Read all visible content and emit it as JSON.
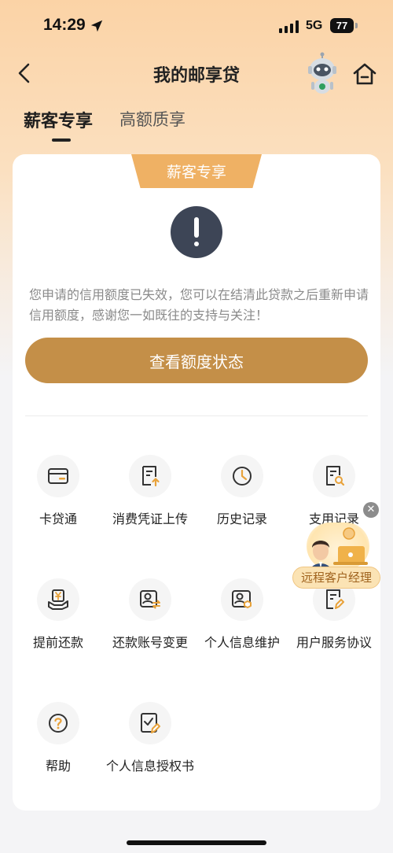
{
  "status_bar": {
    "time": "14:29",
    "network": "5G",
    "battery": "77"
  },
  "header": {
    "title": "我的邮享贷"
  },
  "tabs": [
    {
      "label": "薪客专享",
      "active": true
    },
    {
      "label": "高额质享",
      "active": false
    }
  ],
  "card": {
    "ribbon_label": "薪客专享",
    "message": "您申请的信用额度已失效，您可以在结清此贷款之后重新申请信用额度，感谢您一如既往的支持与关注！",
    "primary_button_label": "查看额度状态"
  },
  "services": [
    {
      "label": "卡贷通",
      "icon": "card-icon"
    },
    {
      "label": "消费凭证上传",
      "icon": "receipt-upload-icon"
    },
    {
      "label": "历史记录",
      "icon": "clock-icon"
    },
    {
      "label": "支用记录",
      "icon": "document-search-icon"
    },
    {
      "label": "提前还款",
      "icon": "yuan-hand-icon"
    },
    {
      "label": "还款账号变更",
      "icon": "account-switch-icon"
    },
    {
      "label": "个人信息维护",
      "icon": "id-card-icon"
    },
    {
      "label": "用户服务协议",
      "icon": "agreement-icon"
    },
    {
      "label": "帮助",
      "icon": "help-icon"
    },
    {
      "label": "个人信息授权书",
      "icon": "authorization-icon"
    }
  ],
  "floating_manager": {
    "label": "远程客户经理"
  },
  "colors": {
    "accent": "#c48f48",
    "ribbon": "#efb164",
    "icon_dark": "#333333",
    "icon_orange": "#e8a23a"
  }
}
